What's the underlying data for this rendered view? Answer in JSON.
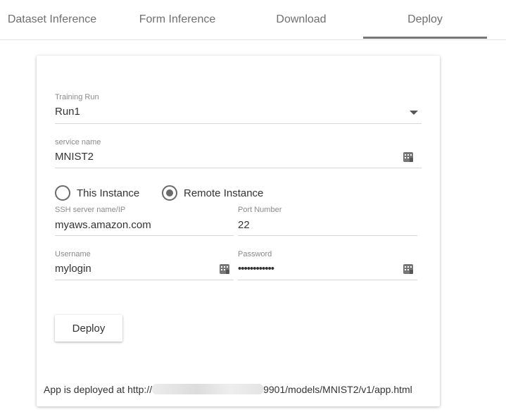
{
  "tabs": [
    {
      "label": "Dataset Inference"
    },
    {
      "label": "Form Inference"
    },
    {
      "label": "Download"
    },
    {
      "label": "Deploy",
      "active": true
    }
  ],
  "form": {
    "training_run": {
      "label": "Training Run",
      "value": "Run1"
    },
    "service_name": {
      "label": "service name",
      "value": "MNIST2"
    },
    "instance_options": [
      {
        "label": "This Instance",
        "selected": false
      },
      {
        "label": "Remote Instance",
        "selected": true
      }
    ],
    "ssh_server": {
      "label": "SSH server name/IP",
      "value": "myaws.amazon.com"
    },
    "port": {
      "label": "Port Number",
      "value": "22"
    },
    "username": {
      "label": "Username",
      "value": "mylogin"
    },
    "password": {
      "label": "Password",
      "value": "••••••••••••"
    }
  },
  "deploy_button": {
    "label": "Deploy"
  },
  "status": {
    "prefix": "App is deployed at http://",
    "suffix": "9901/models/MNIST2/v1/app.html"
  },
  "colors": {
    "tab_indicator": "#777777",
    "radio": "#6a6a6a"
  },
  "icons": {
    "dropdown": "chevron-down-icon",
    "keyboard": "keyboard-icon"
  }
}
